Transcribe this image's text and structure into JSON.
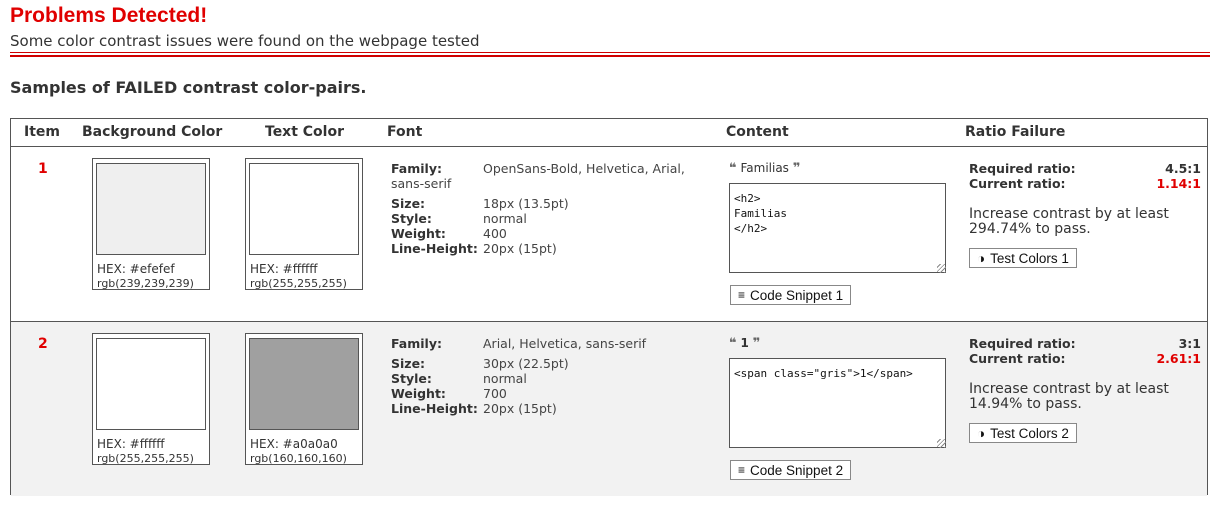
{
  "header": {
    "title": "Problems Detected!",
    "subtitle": "Some color contrast issues were found on the webpage tested"
  },
  "section": {
    "heading": "Samples of FAILED contrast color-pairs."
  },
  "table": {
    "columns": {
      "item": "Item",
      "background": "Background Color",
      "text": "Text Color",
      "font": "Font",
      "content": "Content",
      "ratio": "Ratio Failure"
    },
    "font_labels": {
      "family": "Family:",
      "size": "Size:",
      "style": "Style:",
      "weight": "Weight:",
      "line_height": "Line-Height:"
    },
    "ratio_labels": {
      "required": "Required ratio:",
      "current": "Current ratio:"
    },
    "rows": [
      {
        "item": "1",
        "background": {
          "hex": "HEX: #efefef",
          "rgb": "rgb(239,239,239)",
          "color": "#efefef"
        },
        "text": {
          "hex": "HEX: #ffffff",
          "rgb": "rgb(255,255,255)",
          "color": "#ffffff"
        },
        "font": {
          "family_line1": "OpenSans-Bold, Helvetica, Arial,",
          "family_line2": "sans-serif",
          "size": "18px (13.5pt)",
          "style": "normal",
          "weight": "400",
          "line_height": "20px (15pt)"
        },
        "content": {
          "quote_text": "Familias",
          "code": "<h2>\nFamilias\n</h2>",
          "snippet_label": "Code Snippet 1"
        },
        "ratio": {
          "required": "4.5:1",
          "current": "1.14:1",
          "advice_line1": "Increase contrast by at least",
          "advice_line2": "294.74% to pass.",
          "test_label": "Test Colors 1"
        }
      },
      {
        "item": "2",
        "background": {
          "hex": "HEX: #ffffff",
          "rgb": "rgb(255,255,255)",
          "color": "#ffffff"
        },
        "text": {
          "hex": "HEX: #a0a0a0",
          "rgb": "rgb(160,160,160)",
          "color": "#a0a0a0"
        },
        "font": {
          "family_line1": "Arial, Helvetica, sans-serif",
          "family_line2": "",
          "size": "30px (22.5pt)",
          "style": "normal",
          "weight": "700",
          "line_height": "20px (15pt)"
        },
        "content": {
          "quote_text": "1",
          "code": "<span class=\"gris\">1</span>",
          "snippet_label": "Code Snippet 2"
        },
        "ratio": {
          "required": "3:1",
          "current": "2.61:1",
          "advice_line1": "Increase contrast by at least",
          "advice_line2": "14.94% to pass.",
          "test_label": "Test Colors 2"
        }
      }
    ]
  },
  "icons": {
    "open_quote": "open-quote-icon",
    "close_quote": "close-quote-icon",
    "snippet": "lines-icon",
    "contrast": "half-circle-contrast-icon"
  },
  "colors": {
    "alert_red": "#e00000",
    "row_alt_bg": "#f2f2f2",
    "border": "#555555"
  }
}
